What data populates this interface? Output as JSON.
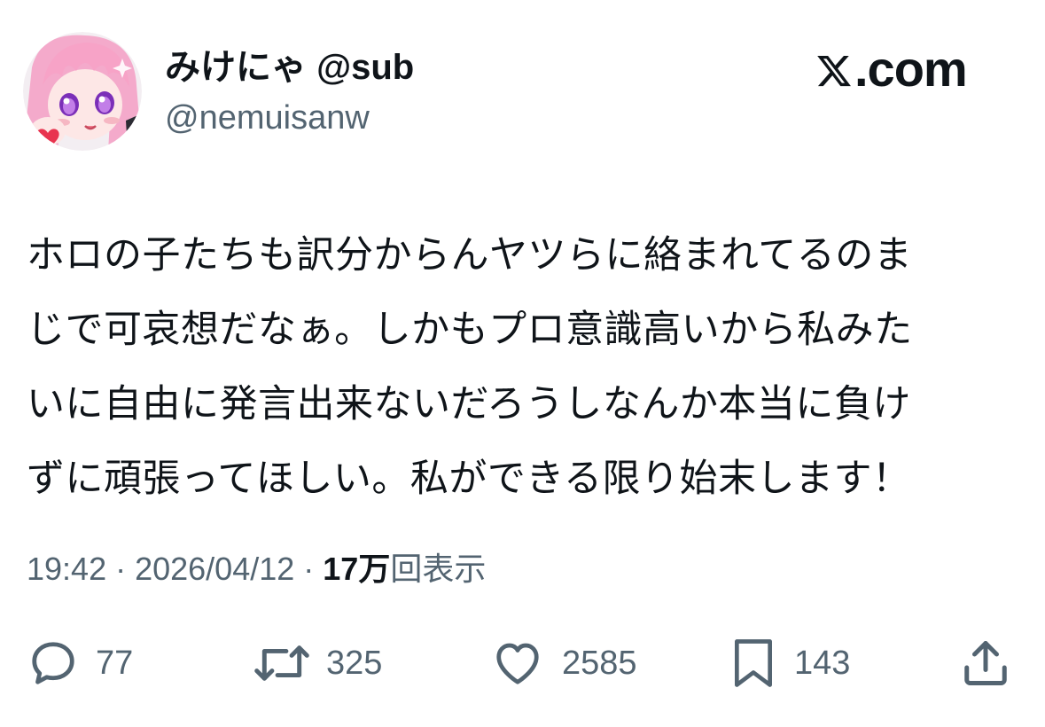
{
  "author": {
    "display_name": "みけにゃ @sub",
    "handle": "@nemuisanw",
    "avatar_icon": "anime-avatar-icon"
  },
  "brand": {
    "logo_icon": "x-logo-icon",
    "label": ".com"
  },
  "tweet": {
    "lines": [
      "ホロの子たちも訳分からんヤツらに絡まれてるのま",
      "じで可哀想だなぁ。しかもプロ意識高いから私みた",
      "いに自由に発言出来ないだろうしなんか本当に負け",
      "ずに頑張ってほしい。私ができる限り始末します！"
    ]
  },
  "meta": {
    "time": "19:42",
    "sep1": " · ",
    "date": "2026/04/12",
    "sep2": " · ",
    "views_count": "17万",
    "views_label": "回表示"
  },
  "actions": {
    "replies": {
      "icon": "reply-icon",
      "count": "77"
    },
    "reposts": {
      "icon": "repost-icon",
      "count": "325"
    },
    "likes": {
      "icon": "heart-icon",
      "count": "2585"
    },
    "bookmarks": {
      "icon": "bookmark-icon",
      "count": "143"
    },
    "share": {
      "icon": "share-icon"
    }
  },
  "colors": {
    "text": "#0f1419",
    "secondary": "#536471",
    "avatar_pink": "#f4b8d0",
    "avatar_hair": "#f7a3c7",
    "avatar_eye": "#a25ad6",
    "heart_red": "#e8344f"
  }
}
